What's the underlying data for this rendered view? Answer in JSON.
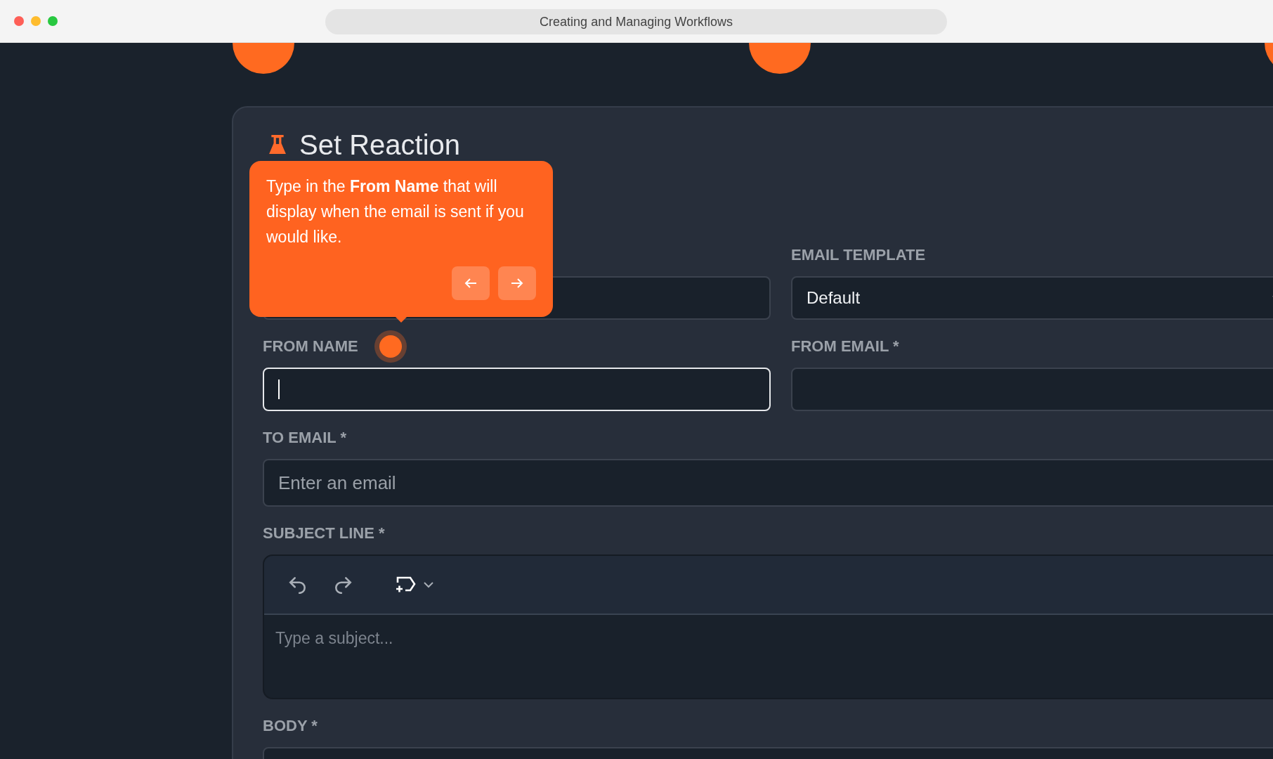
{
  "window": {
    "title": "Creating and Managing Workflows"
  },
  "panel": {
    "title": "Set Reaction"
  },
  "rows": [
    [
      {
        "kind": "select"
      },
      {
        "kind": "select",
        "label": "EMAIL TEMPLATE",
        "value": "Default"
      }
    ],
    [
      {
        "kind": "input",
        "label": "FROM NAME",
        "focused": true,
        "hotspot": true
      },
      {
        "kind": "input",
        "label": "FROM EMAIL *",
        "focused": false
      }
    ],
    [
      {
        "kind": "input",
        "label": "TO EMAIL *",
        "placeholder": "Enter an email",
        "focused": false
      }
    ],
    [
      {
        "kind": "editor",
        "label": "SUBJECT LINE *",
        "placeholder": "Type a subject..."
      }
    ],
    [
      {
        "kind": "input",
        "label": "BODY *"
      }
    ]
  ],
  "tooltip": {
    "text": "Type in the **From Name** that will display when the email is sent if you would like."
  }
}
